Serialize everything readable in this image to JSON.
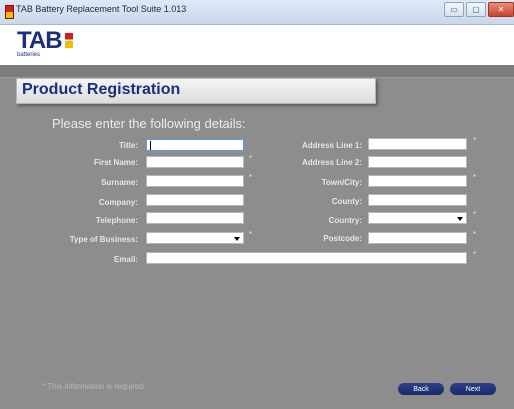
{
  "window": {
    "title": "TAB Battery Replacement Tool Suite 1.013"
  },
  "logo": {
    "brand": "TAB",
    "subtitle": "batteries"
  },
  "panel": {
    "title": "Product Registration"
  },
  "form": {
    "instructions": "Please enter the following details:",
    "left": [
      {
        "label": "Title:",
        "value": "",
        "required": false,
        "type": "text"
      },
      {
        "label": "First Name:",
        "value": "",
        "required": true,
        "type": "text"
      },
      {
        "label": "Surname:",
        "value": "",
        "required": true,
        "type": "text"
      },
      {
        "label": "Company:",
        "value": "",
        "required": false,
        "type": "text"
      },
      {
        "label": "Telephone:",
        "value": "",
        "required": false,
        "type": "text"
      },
      {
        "label": "Type of Business:",
        "value": "",
        "required": true,
        "type": "select"
      }
    ],
    "right": [
      {
        "label": "Address Line 1:",
        "value": "",
        "required": true,
        "type": "text"
      },
      {
        "label": "Address Line 2:",
        "value": "",
        "required": false,
        "type": "text"
      },
      {
        "label": "Town/City:",
        "value": "",
        "required": true,
        "type": "text"
      },
      {
        "label": "County:",
        "value": "",
        "required": false,
        "type": "text"
      },
      {
        "label": "Country:",
        "value": "",
        "required": true,
        "type": "select"
      },
      {
        "label": "Postcode:",
        "value": "",
        "required": true,
        "type": "text"
      }
    ],
    "email": {
      "label": "Email:",
      "value": "",
      "required": true
    },
    "required_marker": "*"
  },
  "footer": {
    "required_note": "*  This information is required"
  },
  "buttons": {
    "back": "Back",
    "next": "Next"
  },
  "colors": {
    "brand": "#1a2f7d",
    "background": "#8d8d8d",
    "button": "#1a2b6a"
  }
}
